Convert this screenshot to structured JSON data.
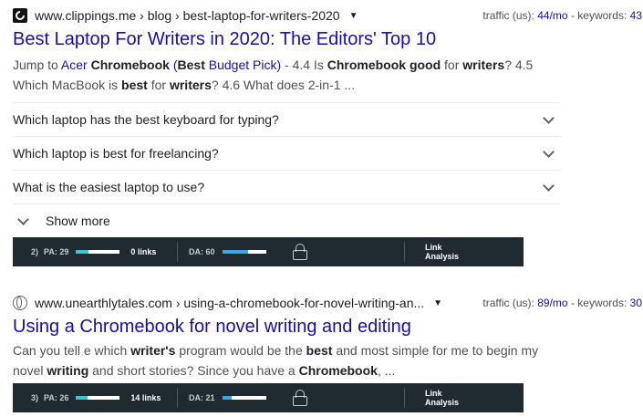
{
  "results": [
    {
      "url": "www.clippings.me › blog › best-laptop-for-writers-2020",
      "traffic_label": "traffic (us):",
      "traffic_value": "44/mo",
      "keywords_label": "- keywords:",
      "keywords_value": "43",
      "title": "Best Laptop For Writers in 2020: The Editors' Top 10",
      "favicon": "clippings-c-icon"
    },
    {
      "url": "www.unearthlytales.com › using-a-chromebook-for-novel-writing-an...",
      "traffic_label": "traffic (us):",
      "traffic_value": "89/mo",
      "keywords_label": "- keywords:",
      "keywords_value": "30",
      "title": "Using a Chromebook for novel writing and editing",
      "favicon": "globe-icon"
    }
  ],
  "snippet1": {
    "p1": "Jump to ",
    "link1": "Acer ",
    "link1b": "Chromebook",
    "link1c": " (",
    "link1d": "Best",
    "link1e": " Budget Pick)",
    "p2": " - 4.4 Is ",
    "b1": "Chromebook good",
    "p3": " for ",
    "b2": "writers",
    "p4": "? 4.5 Which MacBook is ",
    "b3": "best",
    "p5": " for ",
    "b4": "writers",
    "p6": "? 4.6 What does 2-in-1 ..."
  },
  "snippet2": {
    "p1": "Can you tell e which ",
    "b1": "writer's",
    "p2": " program would be the ",
    "b2": "best",
    "p3": " and most simple for me to begin my novel ",
    "b3": "writing",
    "p4": " and short stories? Since you have a ",
    "b4": "Chromebook",
    "p5": ", ..."
  },
  "faq": [
    "Which laptop has the best keyboard for typing?",
    "Which laptop is best for freelancing?",
    "What is the easiest laptop to use?"
  ],
  "show_more": "Show more",
  "moz": [
    {
      "rank": "2)",
      "pa": "PA: 29",
      "pa_fill": 0.29,
      "links": "0 links",
      "da": "DA: 60",
      "da_fill": 0.6,
      "link_analysis_1": "Link",
      "link_analysis_2": "Analysis"
    },
    {
      "rank": "3)",
      "pa": "PA: 26",
      "pa_fill": 0.26,
      "links": "14 links",
      "da": "DA: 21",
      "da_fill": 0.21,
      "link_analysis_1": "Link",
      "link_analysis_2": "Analysis"
    }
  ],
  "colors": {
    "link": "#1a0dab",
    "moz_bg": "#1f2b30",
    "pa_fill": "#38c6cf",
    "da_fill": "#3ba6e0"
  }
}
